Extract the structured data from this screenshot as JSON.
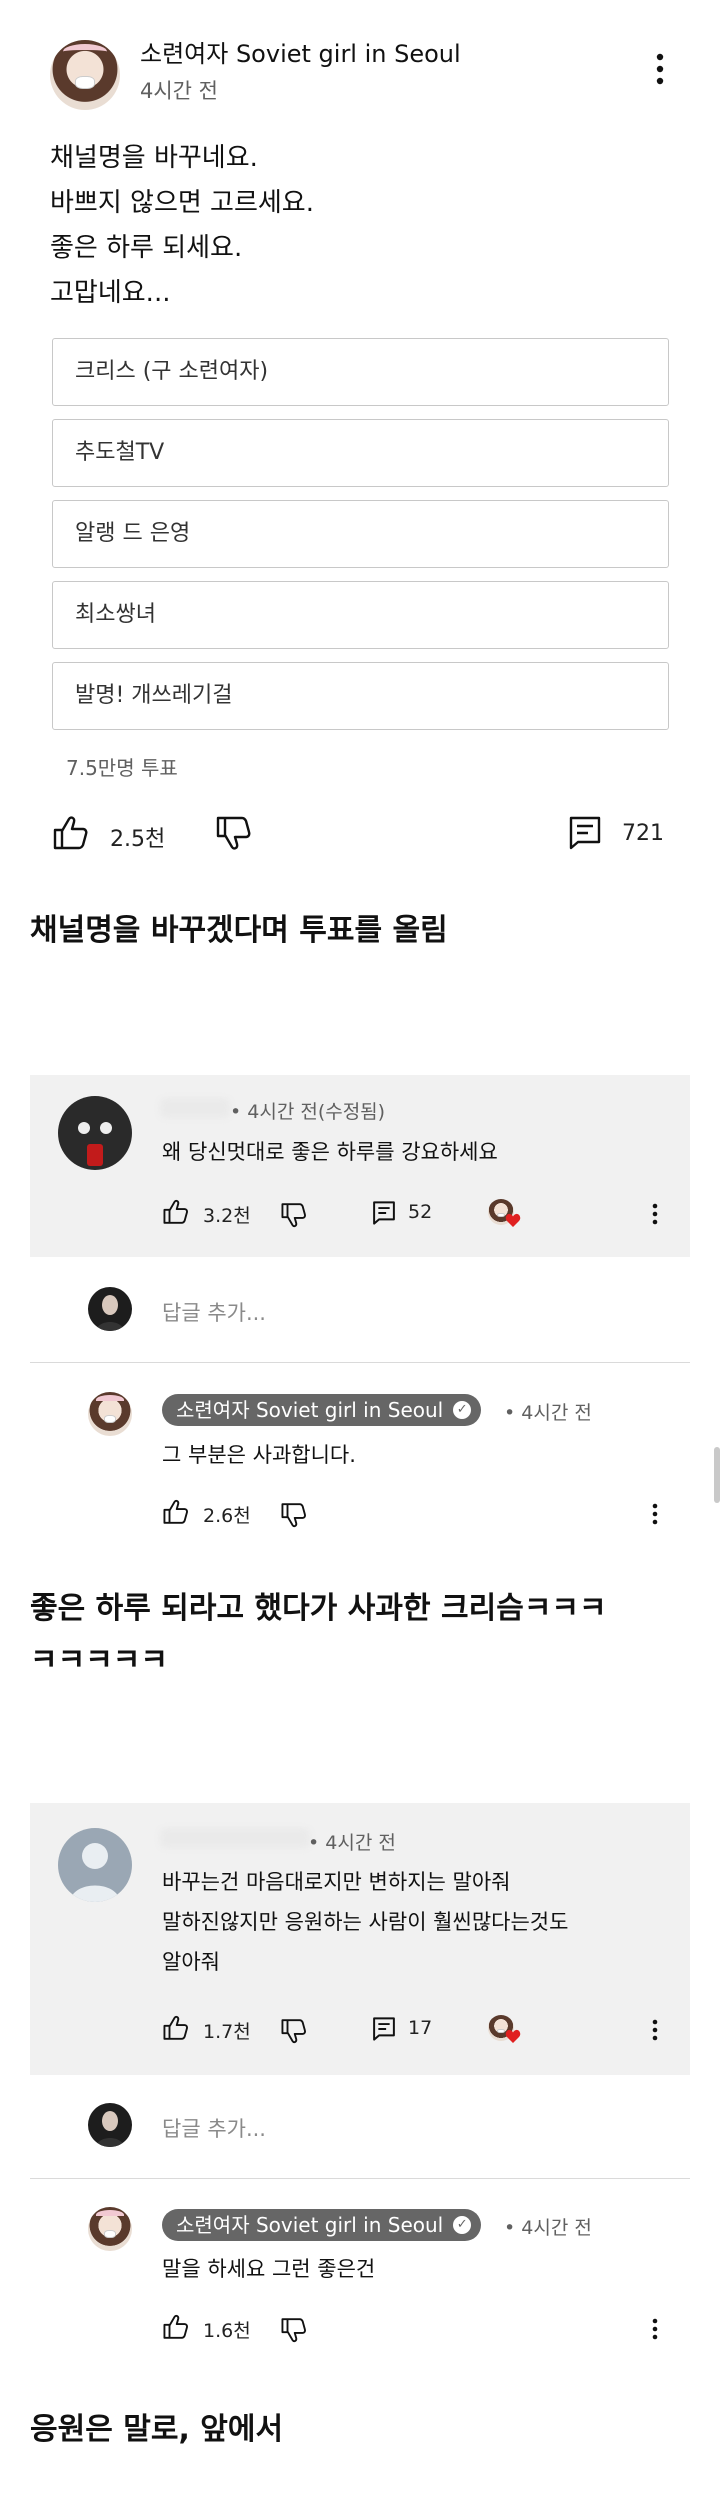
{
  "post": {
    "channel": "소련여자 Soviet girl in Seoul",
    "time": "4시간 전",
    "lines": [
      "채널명을 바꾸네요.",
      "바쁘지 않으면 고르세요.",
      "좋은 하루 되세요.",
      "고맙네요..."
    ],
    "poll_options": [
      "크리스 (구 소련여자)",
      "추도철TV",
      "알랭 드 은영",
      "최소쌍녀",
      "발명! 개쓰레기걸"
    ],
    "votes": "7.5만명 투표",
    "likes": "2.5천",
    "comments": "721"
  },
  "captions": {
    "c1": "채널명을 바꾸겠다며 투표를 올림",
    "c2_line1": "좋은 하루 되라고 했다가 사과한 크리슴ㅋㅋㅋ",
    "c2_line2": "ㅋㅋㅋㅋㅋ",
    "c3": "응원은 말로, 앞에서"
  },
  "thread1": {
    "comment": {
      "time": "• 4시간 전(수정됨)",
      "text": "왜 당신멋대로 좋은 하루를 강요하세요",
      "likes": "3.2천",
      "replies": "52"
    },
    "reply_placeholder": "답글 추가...",
    "owner_reply": {
      "channel": "소련여자 Soviet girl in Seoul",
      "time": "• 4시간 전",
      "text": "그 부분은 사과합니다.",
      "likes": "2.6천"
    }
  },
  "thread2": {
    "comment": {
      "time": "• 4시간 전",
      "lines": [
        "바꾸는건 마음대로지만 변하지는 말아줘",
        "말하진않지만 응원하는 사람이 훨씬많다는것도",
        "알아줘"
      ],
      "likes": "1.7천",
      "replies": "17"
    },
    "reply_placeholder": "답글 추가...",
    "owner_reply": {
      "channel": "소련여자 Soviet girl in Seoul",
      "time": "• 4시간 전",
      "text": "말을 하세요 그런 좋은건",
      "likes": "1.6천"
    }
  },
  "colors": {
    "comment_bg": "#f1f1f1",
    "pill": "#666666",
    "heart": "#e02020"
  }
}
